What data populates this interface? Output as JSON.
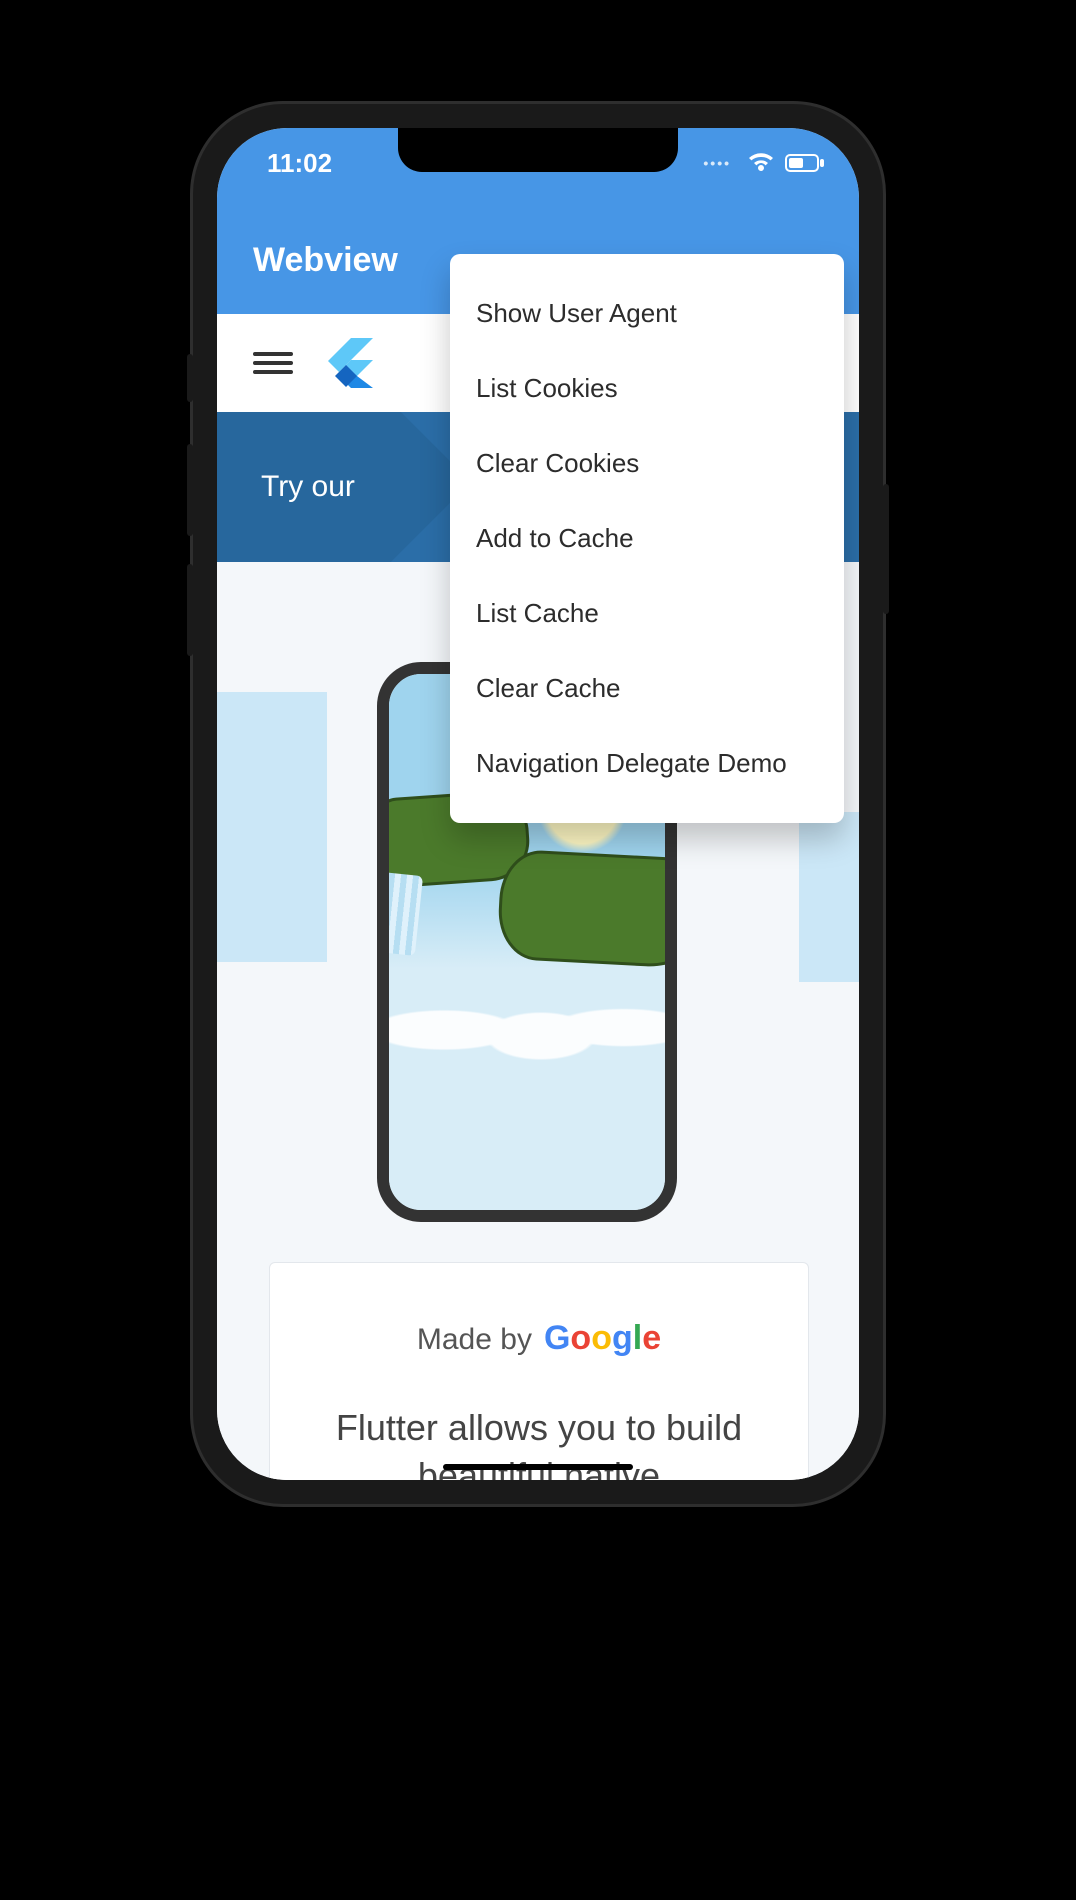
{
  "status": {
    "time": "11:02"
  },
  "app": {
    "title": "Webview"
  },
  "menu": {
    "items": [
      "Show User Agent",
      "List Cookies",
      "Clear Cookies",
      "Add to Cache",
      "List Cache",
      "Clear Cache",
      "Navigation Delegate Demo"
    ]
  },
  "banner": {
    "text": "Try our"
  },
  "card": {
    "made_by_prefix": "Made by",
    "google": [
      "G",
      "o",
      "o",
      "g",
      "l",
      "e"
    ],
    "copy": "Flutter allows you to build beautiful native"
  }
}
